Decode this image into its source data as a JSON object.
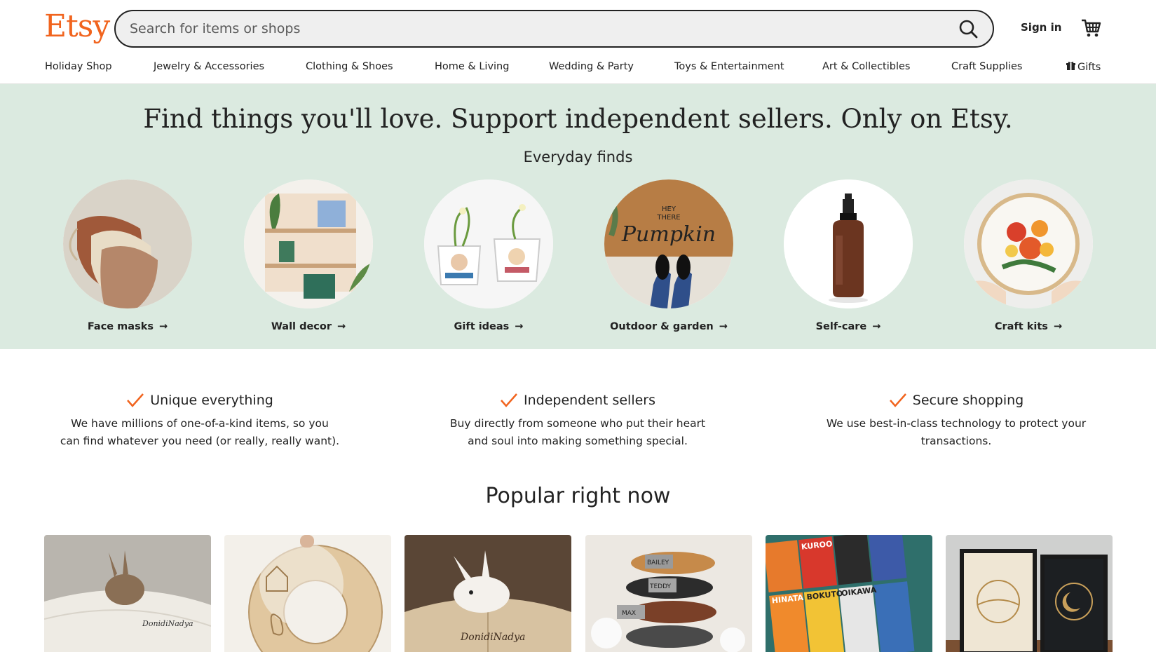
{
  "header": {
    "logo": "Etsy",
    "search_placeholder": "Search for items or shops",
    "sign_in": "Sign in",
    "brand_color": "#f1641e"
  },
  "nav": {
    "items": [
      {
        "label": "Holiday Shop"
      },
      {
        "label": "Jewelry & Accessories"
      },
      {
        "label": "Clothing & Shoes"
      },
      {
        "label": "Home & Living"
      },
      {
        "label": "Wedding & Party"
      },
      {
        "label": "Toys & Entertainment"
      },
      {
        "label": "Art & Collectibles"
      },
      {
        "label": "Craft Supplies"
      },
      {
        "label": "Gifts",
        "icon": "gift-icon"
      }
    ]
  },
  "hero": {
    "title": "Find things you'll love. Support independent sellers. Only on Etsy.",
    "subtitle": "Everyday finds",
    "background": "#dbeae0",
    "categories": [
      {
        "label": "Face masks"
      },
      {
        "label": "Wall decor"
      },
      {
        "label": "Gift ideas"
      },
      {
        "label": "Outdoor & garden"
      },
      {
        "label": "Self-care"
      },
      {
        "label": "Craft kits"
      }
    ]
  },
  "features": [
    {
      "title": "Unique everything",
      "line1": "We have millions of one-of-a-kind items, so you",
      "line2": "can find whatever you need (or really, really want)."
    },
    {
      "title": "Independent sellers",
      "line1": "Buy directly from someone who put their heart",
      "line2": "and soul into making something special."
    },
    {
      "title": "Secure shopping",
      "line1": "We use best-in-class technology to protect your",
      "line2": "transactions."
    }
  ],
  "popular": {
    "title": "Popular right now",
    "tile_names": [
      "DonidiNadya",
      "DonidiNadya",
      "BAILEY",
      "TEDDY",
      "MAX",
      "HINATA",
      "KUROO",
      "BOKUTO",
      "OIKAWA"
    ]
  }
}
